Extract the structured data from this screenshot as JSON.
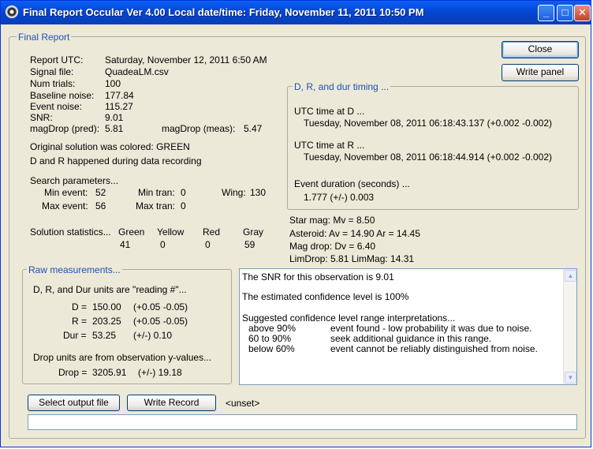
{
  "window": {
    "title": "Final Report Occular Ver 4.00  Local date/time:  Friday, November 11, 2011  10:50 PM",
    "minimize_glyph": "_",
    "maximize_glyph": "□",
    "close_glyph": "✕",
    "icon": "occular-app-icon"
  },
  "final_report": {
    "legend": "Final Report",
    "rows": [
      {
        "label": "Report UTC:",
        "value": "Saturday, November 12, 2011 6:50 AM"
      },
      {
        "label": "Signal file:",
        "value": "QuadeaLM.csv"
      },
      {
        "label": "Num trials:",
        "value": "100"
      },
      {
        "label": "Baseline noise:",
        "value": "177.84"
      },
      {
        "label": "Event noise:",
        "value": "115.27"
      },
      {
        "label": "SNR:",
        "value": "9.01"
      }
    ],
    "magdrop_pred_label": "magDrop (pred):",
    "magdrop_pred_value": "5.81",
    "magdrop_meas_label": "magDrop (meas):",
    "magdrop_meas_value": "5.47",
    "colored_line": "Original solution was colored:  GREEN",
    "dr_line": "D and R happened during data recording",
    "search_title": "Search parameters...",
    "min_event_label": "Min event:",
    "min_event_value": "52",
    "min_tran_label": "Min tran:",
    "min_tran_value": "0",
    "wing_label": "Wing:",
    "wing_value": "130",
    "max_event_label": "Max event:",
    "max_event_value": "56",
    "max_tran_label": "Max tran:",
    "max_tran_value": "0",
    "solution_stats_label": "Solution statistics...",
    "stats": [
      {
        "color": "Green",
        "count": "41"
      },
      {
        "color": "Yellow",
        "count": "0"
      },
      {
        "color": "Red",
        "count": "0"
      },
      {
        "color": "Gray",
        "count": "59"
      }
    ]
  },
  "buttons": {
    "close": "Close",
    "write_panel": "Write panel",
    "select_output_file": "Select output file",
    "write_record": "Write Record",
    "unset_label": "<unset>"
  },
  "timing": {
    "legend": "D, R, and dur timing ...",
    "d_label": "UTC time at D ...",
    "d_value": "Tuesday, November 08, 2011 06:18:43.137 (+0.002 -0.002)",
    "r_label": "UTC time at R ...",
    "r_value": "Tuesday, November 08, 2011 06:18:44.914 (+0.002 -0.002)",
    "dur_label": "Event duration (seconds) ...",
    "dur_value": "1.777  (+/-)  0.003"
  },
  "star_info": {
    "star_mag": "Star mag: Mv = 8.50",
    "asteroid": "Asteroid:  Av = 14.90 Ar = 14.45",
    "mag_drop": "Mag drop: Dv = 6.40",
    "limits": "LimDrop: 5.81  LimMag: 14.31"
  },
  "raw": {
    "legend": "Raw measurements...",
    "units_line": "D, R, and Dur units are \"reading #\"...",
    "rows": [
      {
        "label": "D =",
        "value": "150.00",
        "err": "(+0.05 -0.05)"
      },
      {
        "label": "R =",
        "value": "203.25",
        "err": "(+0.05 -0.05)"
      },
      {
        "label": "Dur =",
        "value": "53.25",
        "err": "(+/-)  0.10"
      }
    ],
    "drop_units_line": "Drop units are from observation y-values...",
    "drop_label": "Drop =",
    "drop_value": "3205.91",
    "drop_err": "(+/-)  19.18"
  },
  "memo": {
    "line1": "The SNR for this observation is 9.01",
    "line2": "The estimated confidence level is  100%",
    "line3": "Suggested confidence level range interpretations...",
    "ranges": [
      {
        "range": "above 90%",
        "meaning": "event found - low probability it was due to noise."
      },
      {
        "range": "60 to 90%",
        "meaning": "seek additional guidance in this range."
      },
      {
        "range": "below 60%",
        "meaning": "event cannot be reliably distinguished from noise."
      }
    ]
  },
  "output_field": {
    "value": ""
  }
}
